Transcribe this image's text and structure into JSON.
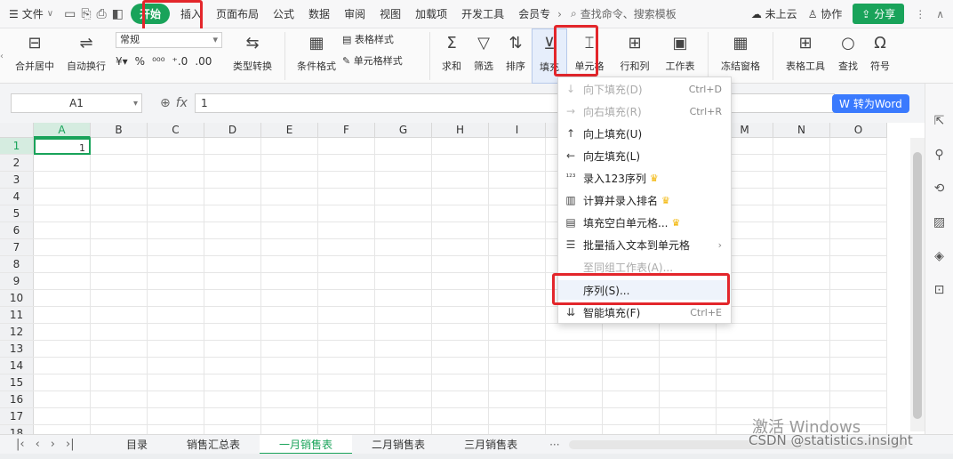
{
  "menubar": {
    "file_label": "文件",
    "tabs": [
      "开始",
      "插入",
      "页面布局",
      "公式",
      "数据",
      "审阅",
      "视图",
      "加载项",
      "开发工具",
      "会员专"
    ],
    "search_placeholder": "查找命令、搜索模板",
    "cloud": "未上云",
    "collab": "协作",
    "share": "分享"
  },
  "ribbon": {
    "merge": "合并居中",
    "wrap": "自动换行",
    "number_format": "常规",
    "percent": "%",
    "type_convert": "类型转换",
    "cond_format": "条件格式",
    "table_style": "表格样式",
    "cell_style": "单元格样式",
    "sum": "求和",
    "filter": "筛选",
    "sort": "排序",
    "fill": "填充",
    "cell": "单元格",
    "row_col": "行和列",
    "worksheet": "工作表",
    "freeze": "冻结窗格",
    "table_tools": "表格工具",
    "find": "查找",
    "symbol": "符号"
  },
  "formula_bar": {
    "name_box": "A1",
    "value": "1",
    "to_word": "转为Word"
  },
  "grid": {
    "columns": [
      "A",
      "B",
      "C",
      "D",
      "E",
      "F",
      "G",
      "H",
      "I",
      "J",
      "K",
      "L",
      "M",
      "N",
      "O"
    ],
    "rows": [
      "1",
      "2",
      "3",
      "4",
      "5",
      "6",
      "7",
      "8",
      "9",
      "10",
      "11",
      "12",
      "13",
      "14",
      "15",
      "16",
      "17",
      "18"
    ],
    "a1_value": "1"
  },
  "fill_menu": {
    "items": [
      {
        "label": "向下填充(D)",
        "shortcut": "Ctrl+D",
        "icon": "arrow-down-icon",
        "glyph": "↓",
        "disabled": true
      },
      {
        "label": "向右填充(R)",
        "shortcut": "Ctrl+R",
        "icon": "arrow-right-icon",
        "glyph": "→",
        "disabled": true
      },
      {
        "label": "向上填充(U)",
        "shortcut": "",
        "icon": "arrow-up-icon",
        "glyph": "↑",
        "disabled": false
      },
      {
        "label": "向左填充(L)",
        "shortcut": "",
        "icon": "arrow-left-icon",
        "glyph": "←",
        "disabled": false
      },
      {
        "label": "录入123序列",
        "shortcut": "",
        "icon": "sequence-123-icon",
        "glyph": "¹²³",
        "disabled": false,
        "crown": true
      },
      {
        "label": "计算并录入排名",
        "shortcut": "",
        "icon": "rank-icon",
        "glyph": "▥",
        "disabled": false,
        "crown": true
      },
      {
        "label": "填充空白单元格...",
        "shortcut": "",
        "icon": "blank-cell-icon",
        "glyph": "▤",
        "disabled": false,
        "crown": true
      },
      {
        "label": "批量插入文本到单元格",
        "shortcut": "›",
        "icon": "insert-text-icon",
        "glyph": "☰",
        "disabled": false
      },
      {
        "label": "至同组工作表(A)...",
        "shortcut": "",
        "icon": "",
        "glyph": "",
        "disabled": true
      },
      {
        "label": "序列(S)...",
        "shortcut": "",
        "icon": "",
        "glyph": "",
        "disabled": false
      },
      {
        "label": "智能填充(F)",
        "shortcut": "Ctrl+E",
        "icon": "smart-fill-icon",
        "glyph": "⇊",
        "disabled": false
      }
    ]
  },
  "sheets": [
    "目录",
    "销售汇总表",
    "一月销售表",
    "二月销售表",
    "三月销售表"
  ],
  "active_sheet": "一月销售表",
  "watermark": "激活 Windows",
  "credit": "CSDN @statistics.insight",
  "colors": {
    "accent": "#19a35a",
    "highlight": "#e3262b",
    "word_btn": "#3a7afe"
  }
}
